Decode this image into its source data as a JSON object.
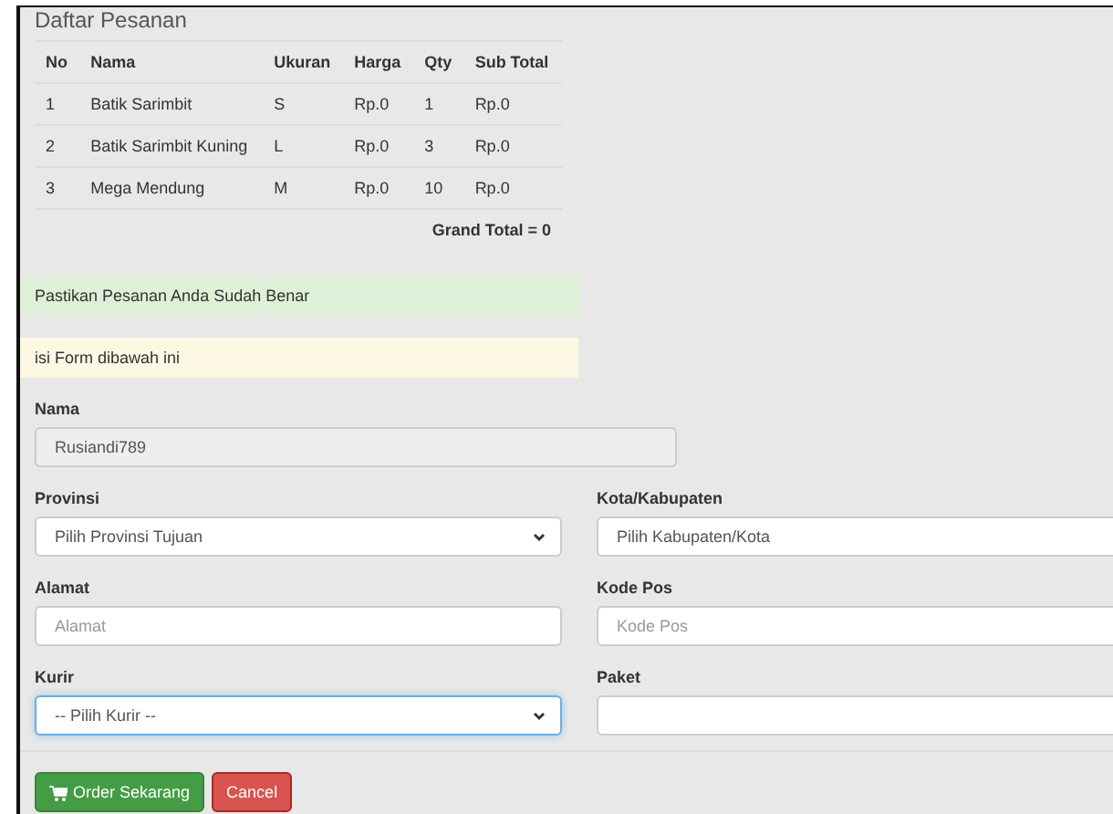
{
  "title": "Daftar Pesanan",
  "table": {
    "columns": [
      "No",
      "Nama",
      "Ukuran",
      "Harga",
      "Qty",
      "Sub Total"
    ],
    "rows": [
      [
        "1",
        "Batik Sarimbit",
        "S",
        "Rp.0",
        "1",
        "Rp.0"
      ],
      [
        "2",
        "Batik Sarimbit Kuning",
        "L",
        "Rp.0",
        "3",
        "Rp.0"
      ],
      [
        "3",
        "Mega Mendung",
        "M",
        "Rp.0",
        "10",
        "Rp.0"
      ]
    ],
    "grand_total": "Grand Total = 0"
  },
  "alerts": [
    {
      "kind": "success",
      "text": "Pastikan Pesanan Anda Sudah Benar"
    },
    {
      "kind": "warning",
      "text": "isi Form dibawah ini"
    }
  ],
  "nama": {
    "label": "Nama",
    "value": "Rusiandi789"
  },
  "fields": [
    {
      "kind": "select",
      "label": "Provinsi",
      "value": "Pilih Provinsi Tujuan",
      "focused": false
    },
    {
      "kind": "select",
      "label": "Kota/Kabupaten",
      "value": "Pilih Kabupaten/Kota",
      "focused": false
    },
    {
      "kind": "input",
      "label": "Alamat",
      "placeholder": "Alamat",
      "focused": false
    },
    {
      "kind": "input",
      "label": "Kode Pos",
      "placeholder": "Kode Pos",
      "focused": false
    },
    {
      "kind": "select",
      "label": "Kurir",
      "value": "-- Pilih Kurir --",
      "focused": true
    },
    {
      "kind": "select",
      "label": "Paket",
      "focused": false
    }
  ],
  "buttons": [
    {
      "kind": "primary",
      "label": "Order Sekarang"
    },
    {
      "kind": "danger",
      "label": "Cancel"
    }
  ]
}
